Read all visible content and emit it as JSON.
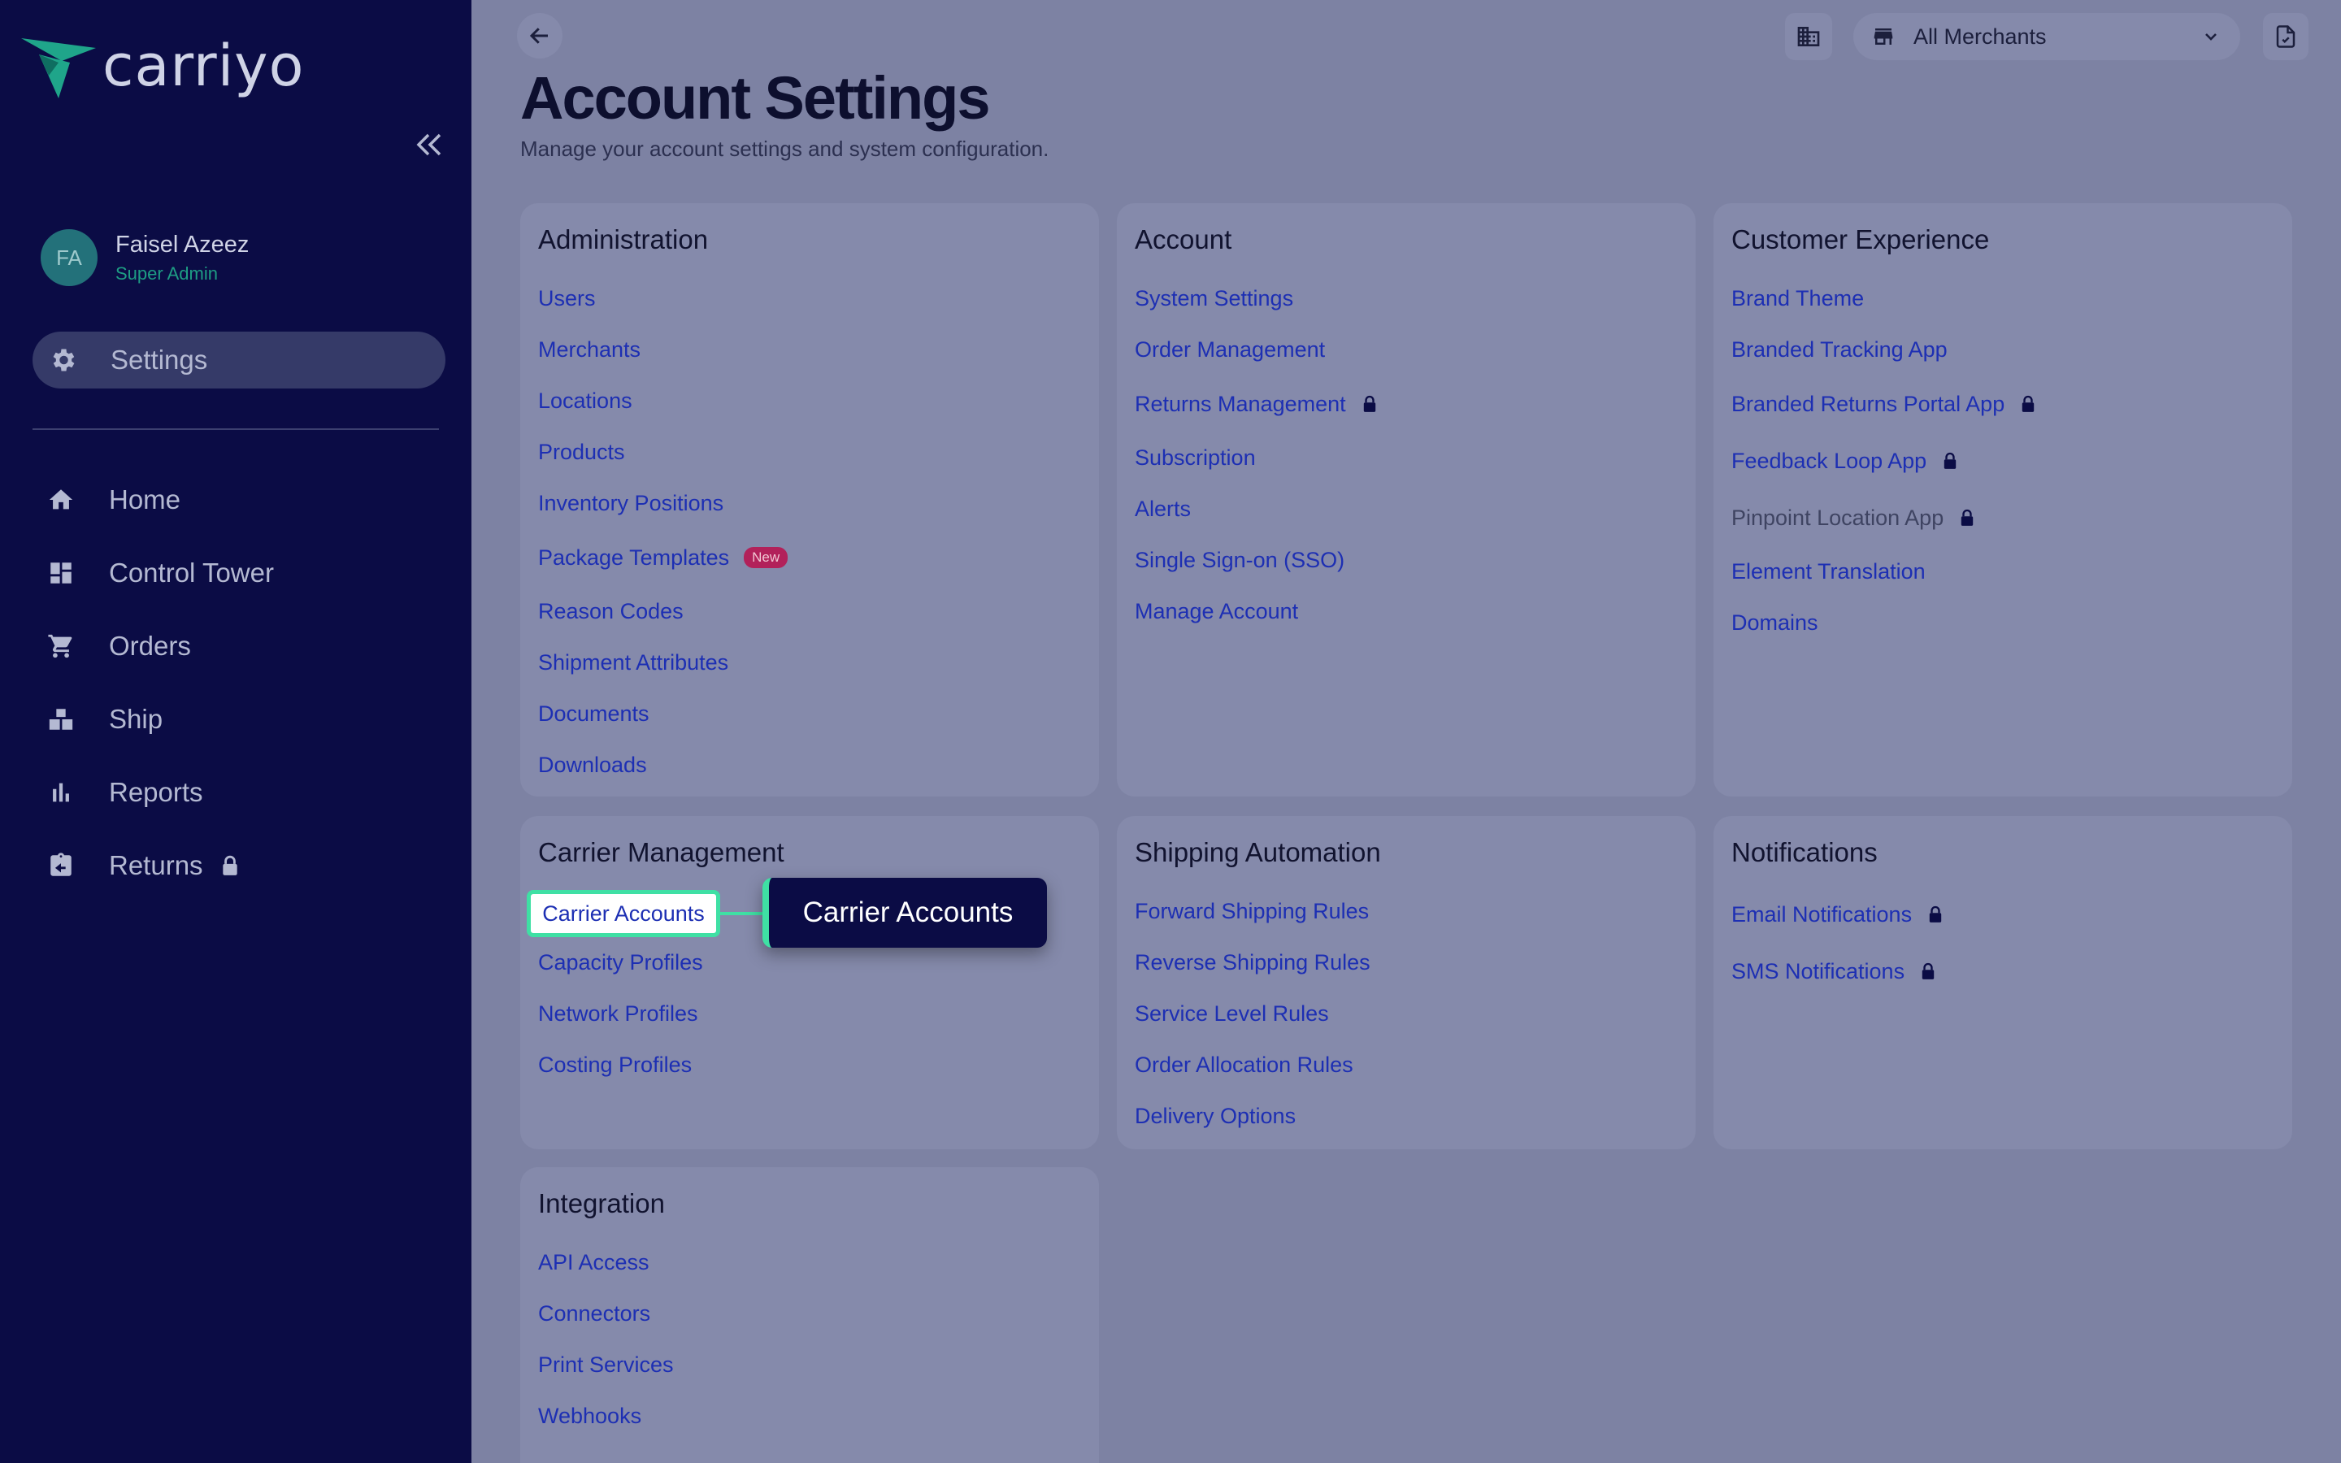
{
  "brand": {
    "name": "carriyo",
    "accent": "#1fa58a",
    "sidebar_bg": "#0b0c45",
    "highlight": "#3fe0a4"
  },
  "user": {
    "initials": "FA",
    "name": "Faisel Azeez",
    "role": "Super Admin"
  },
  "sidebar": {
    "active": {
      "label": "Settings",
      "icon": "gear-icon"
    },
    "items": [
      {
        "label": "Home",
        "icon": "home-icon",
        "locked": false
      },
      {
        "label": "Control Tower",
        "icon": "dashboard-icon",
        "locked": false
      },
      {
        "label": "Orders",
        "icon": "cart-icon",
        "locked": false
      },
      {
        "label": "Ship",
        "icon": "boxes-icon",
        "locked": false
      },
      {
        "label": "Reports",
        "icon": "bar-chart-icon",
        "locked": false
      },
      {
        "label": "Returns",
        "icon": "return-box-icon",
        "locked": true
      }
    ]
  },
  "header": {
    "merchant_select": "All Merchants",
    "title": "Account Settings",
    "subtitle": "Manage your account settings and system configuration."
  },
  "cards": {
    "administration": {
      "title": "Administration",
      "links": [
        "Users",
        "Merchants",
        "Locations",
        "Products",
        "Inventory Positions",
        "Package Templates",
        "Reason Codes",
        "Shipment Attributes",
        "Documents",
        "Downloads"
      ],
      "badge": "New"
    },
    "account": {
      "title": "Account",
      "links": [
        "System Settings",
        "Order Management",
        "Returns Management",
        "Subscription",
        "Alerts",
        "Single Sign-on (SSO)",
        "Manage Account"
      ]
    },
    "customer_experience": {
      "title": "Customer Experience",
      "links": [
        "Brand Theme",
        "Branded Tracking App",
        "Branded Returns Portal App",
        "Feedback Loop App",
        "Pinpoint Location App",
        "Element Translation",
        "Domains"
      ]
    },
    "carrier_management": {
      "title": "Carrier Management",
      "links": [
        "Carrier Accounts",
        "Capacity Profiles",
        "Network Profiles",
        "Costing Profiles"
      ]
    },
    "shipping_automation": {
      "title": "Shipping Automation",
      "links": [
        "Forward Shipping Rules",
        "Reverse Shipping Rules",
        "Service Level Rules",
        "Order Allocation Rules",
        "Delivery Options"
      ]
    },
    "notifications": {
      "title": "Notifications",
      "links": [
        "Email Notifications",
        "SMS Notifications"
      ]
    },
    "integration": {
      "title": "Integration",
      "links": [
        "API Access",
        "Connectors",
        "Print Services",
        "Webhooks"
      ]
    }
  },
  "tooltip": {
    "label": "Carrier Accounts"
  }
}
